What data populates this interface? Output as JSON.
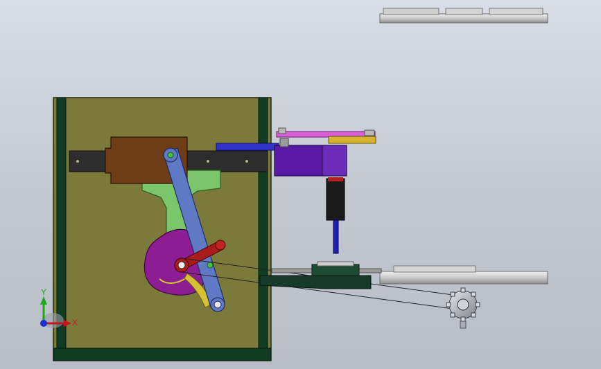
{
  "viewport": {
    "background_top": "#d9dde5",
    "background_bottom": "#b9bec6"
  },
  "frame": {
    "panel_color": "#7b7a3a",
    "post_color": "#123b23"
  },
  "colors": {
    "slide_block": "#6e3d18",
    "rail": "#2d2d2d",
    "rod_blue": "#3233c8",
    "slider_green": "#7bc56a",
    "link_blue": "#5f79c4",
    "cam_magenta": "#8c1d93",
    "crank_red": "#a81c1c",
    "actuator_purple": "#5a1aa5",
    "top_link_pink": "#d85fd7",
    "bracket_yellow": "#d6b42d",
    "cylinder_black": "#1a1a1a",
    "pin_blue": "#1f1fb5",
    "gear_gray": "#bfc3c9",
    "wheel_gray": "#c8c8c8"
  },
  "triad": {
    "x_label": "X",
    "y_label": "Y",
    "x_color": "#c8141e",
    "y_color": "#1ea81e",
    "z_color": "#1a2fd1"
  }
}
